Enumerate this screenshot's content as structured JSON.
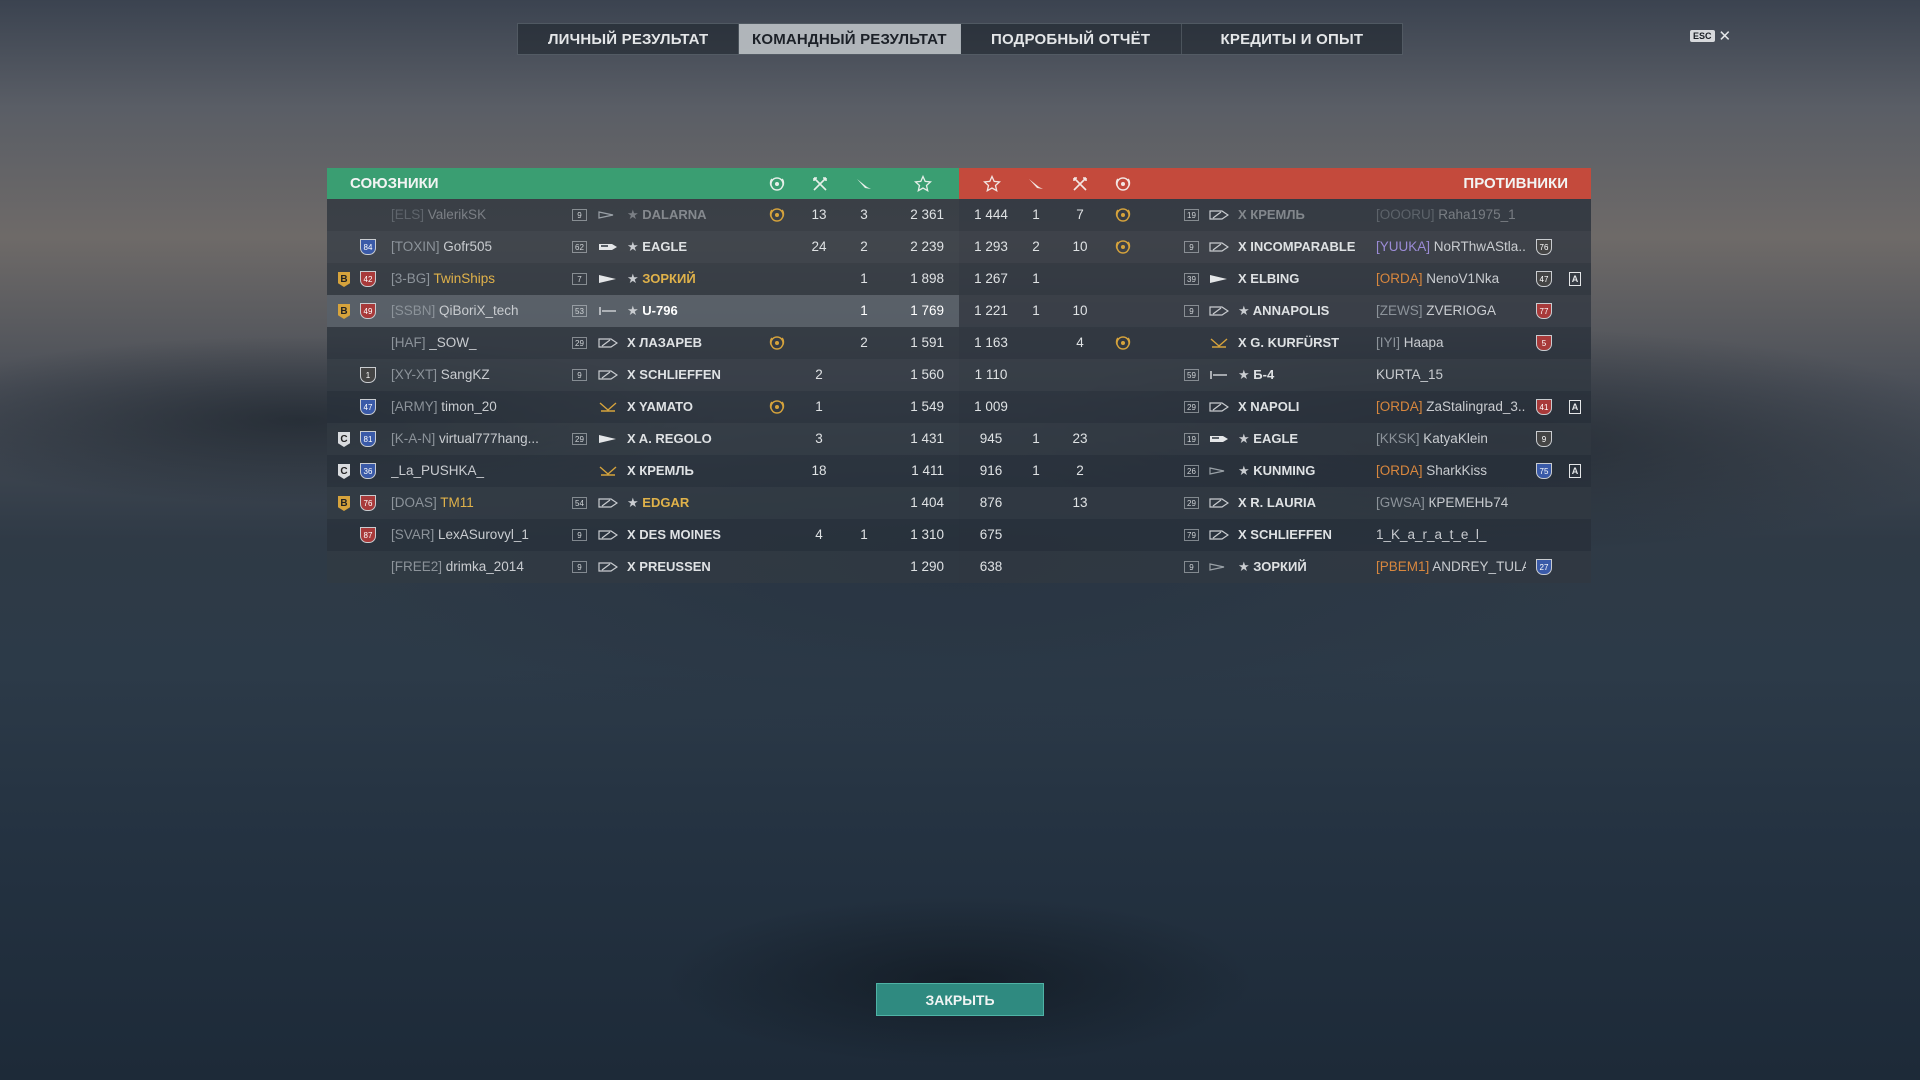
{
  "tabs": [
    {
      "label": "ЛИЧНЫЙ РЕЗУЛЬТАТ",
      "active": false
    },
    {
      "label": "КОМАНДНЫЙ РЕЗУЛЬТАТ",
      "active": true
    },
    {
      "label": "ПОДРОБНЫЙ ОТЧЁТ",
      "active": false
    },
    {
      "label": "КРЕДИТЫ И ОПЫТ",
      "active": false
    }
  ],
  "esc": {
    "key": "ESC",
    "icon": "close-icon"
  },
  "allies": {
    "title": "СОЮЗНИКИ",
    "color": "#3a9e72",
    "columns": [
      "laurel-icon",
      "frags-icon",
      "planes-icon",
      "star-icon"
    ],
    "rows": [
      {
        "badge": "",
        "rank": "",
        "rank_color": "",
        "clan": "[ELS]",
        "name": "ValerikSK",
        "level": "9",
        "ship_type": "cruiser",
        "premium_star": true,
        "ship": "DALARNA",
        "laurel": true,
        "frags": "13",
        "planes": "3",
        "xp": "2 361",
        "dim": true
      },
      {
        "badge": "",
        "rank": "84",
        "rank_color": "#3a5aa8",
        "clan": "[TOXIN]",
        "name": "Gofr505",
        "level": "62",
        "ship_type": "carrier",
        "premium_star": true,
        "ship": "EAGLE",
        "laurel": false,
        "frags": "24",
        "planes": "2",
        "xp": "2 239",
        "dim": false
      },
      {
        "badge": "B",
        "rank": "42",
        "rank_color": "#a83a3a",
        "clan": "[3-BG]",
        "name": "TwinShips",
        "level": "7",
        "ship_type": "destroyer",
        "premium_star": true,
        "ship": "ЗОРКИЙ",
        "laurel": false,
        "frags": "",
        "planes": "1",
        "xp": "1 898",
        "dim": false,
        "gold": true
      },
      {
        "badge": "B",
        "rank": "49",
        "rank_color": "#a83a3a",
        "clan": "[SSBN]",
        "name": "QiBoriX_tech",
        "level": "53",
        "ship_type": "submarine",
        "premium_star": true,
        "ship": "U-796",
        "laurel": false,
        "frags": "",
        "planes": "1",
        "xp": "1 769",
        "dim": false,
        "me": true
      },
      {
        "badge": "",
        "rank": "",
        "rank_color": "",
        "clan": "[HAF]",
        "name": "_SOW_",
        "level": "29",
        "ship_type": "battleship",
        "premium_star": false,
        "ship": "X ЛАЗАРЕВ",
        "laurel": true,
        "frags": "",
        "planes": "2",
        "xp": "1 591",
        "dim": false
      },
      {
        "badge": "",
        "rank": "1",
        "rank_color": "#444",
        "clan": "[XY-XT]",
        "name": "SangKZ",
        "level": "9",
        "ship_type": "battleship",
        "premium_star": false,
        "ship": "X SCHLIEFFEN",
        "laurel": false,
        "frags": "2",
        "planes": "",
        "xp": "1 560",
        "dim": false
      },
      {
        "badge": "",
        "rank": "47",
        "rank_color": "#3a5aa8",
        "clan": "[ARMY]",
        "name": "timon_20",
        "level": "",
        "ship_type": "submarine-v",
        "premium_star": false,
        "ship": "X YAMATO",
        "laurel": true,
        "frags": "1",
        "planes": "",
        "xp": "1 549",
        "dim": false
      },
      {
        "badge": "C",
        "rank": "81",
        "rank_color": "#3a5aa8",
        "clan": "[K-A-N]",
        "name": "virtual777hang...",
        "level": "29",
        "ship_type": "destroyer",
        "premium_star": false,
        "ship": "X A. REGOLO",
        "laurel": false,
        "frags": "3",
        "planes": "",
        "xp": "1 431",
        "dim": false
      },
      {
        "badge": "C",
        "rank": "36",
        "rank_color": "#3a5aa8",
        "clan": "",
        "name": "_La_PUSHKA_",
        "level": "",
        "ship_type": "submarine-v",
        "premium_star": false,
        "ship": "X КРЕМЛЬ",
        "laurel": false,
        "frags": "18",
        "planes": "",
        "xp": "1 411",
        "dim": false
      },
      {
        "badge": "B",
        "rank": "76",
        "rank_color": "#a83a3a",
        "clan": "[DOAS]",
        "name": "TM11",
        "level": "54",
        "ship_type": "battleship",
        "premium_star": true,
        "ship": "EDGAR",
        "laurel": false,
        "frags": "",
        "planes": "",
        "xp": "1 404",
        "dim": false,
        "gold": true
      },
      {
        "badge": "",
        "rank": "87",
        "rank_color": "#a83a3a",
        "clan": "[SVAR]",
        "name": "LexASurovyl_1",
        "level": "9",
        "ship_type": "battleship",
        "premium_star": false,
        "ship": "X DES MOINES",
        "laurel": false,
        "frags": "4",
        "planes": "1",
        "xp": "1 310",
        "dim": false
      },
      {
        "badge": "",
        "rank": "",
        "rank_color": "",
        "clan": "[FREE2]",
        "name": "drimka_2014",
        "level": "9",
        "ship_type": "battleship",
        "premium_star": false,
        "ship": "X PREUSSEN",
        "laurel": false,
        "frags": "",
        "planes": "",
        "xp": "1 290",
        "dim": false
      }
    ]
  },
  "enemies": {
    "title": "ПРОТИВНИКИ",
    "color": "#c44a3c",
    "columns": [
      "star-icon",
      "planes-icon",
      "frags-icon",
      "laurel-icon"
    ],
    "rows": [
      {
        "xp": "1 444",
        "planes": "1",
        "frags": "7",
        "laurel": true,
        "level": "19",
        "ship_type": "battleship",
        "premium_star": false,
        "ship": "X КРЕМЛЬ",
        "clan": "[OOORU]",
        "clan_style": "",
        "name": "Raha1975_1",
        "rank": "",
        "rank_color": "",
        "a": false,
        "dim": true
      },
      {
        "xp": "1 293",
        "planes": "2",
        "frags": "10",
        "laurel": true,
        "level": "9",
        "ship_type": "battleship",
        "premium_star": false,
        "ship": "X INCOMPARABLE",
        "clan": "[YUUKA]",
        "clan_style": "purple",
        "name": "NoRThwAStla...",
        "rank": "76",
        "rank_color": "#444",
        "a": false,
        "dim": false
      },
      {
        "xp": "1 267",
        "planes": "1",
        "frags": "",
        "laurel": false,
        "level": "39",
        "ship_type": "destroyer",
        "premium_star": false,
        "ship": "X ELBING",
        "clan": "[ORDA]",
        "clan_style": "orange",
        "name": "NenoV1Nka",
        "rank": "47",
        "rank_color": "#444",
        "a": true,
        "dim": false
      },
      {
        "xp": "1 221",
        "planes": "1",
        "frags": "10",
        "laurel": false,
        "level": "9",
        "ship_type": "battleship",
        "premium_star": true,
        "ship": "ANNAPOLIS",
        "clan": "[ZEWS]",
        "clan_style": "",
        "name": "ZVERIOGA",
        "rank": "77",
        "rank_color": "#a83a3a",
        "a": false,
        "dim": false
      },
      {
        "xp": "1 163",
        "planes": "",
        "frags": "4",
        "laurel": true,
        "level": "",
        "ship_type": "submarine-v",
        "premium_star": false,
        "ship": "X G. KURFÜRST",
        "clan": "[IYI]",
        "clan_style": "",
        "name": "Haapa",
        "rank": "5",
        "rank_color": "#a83a3a",
        "a": false,
        "dim": false
      },
      {
        "xp": "1 110",
        "planes": "",
        "frags": "",
        "laurel": false,
        "level": "59",
        "ship_type": "submarine",
        "premium_star": true,
        "ship": "Б-4",
        "clan": "",
        "clan_style": "",
        "name": "KURTA_15",
        "rank": "",
        "rank_color": "",
        "a": false,
        "dim": false
      },
      {
        "xp": "1 009",
        "planes": "",
        "frags": "",
        "laurel": false,
        "level": "29",
        "ship_type": "battleship",
        "premium_star": false,
        "ship": "X NAPOLI",
        "clan": "[ORDA]",
        "clan_style": "orange",
        "name": "ZaStalingrad_3...",
        "rank": "41",
        "rank_color": "#a83a3a",
        "a": true,
        "dim": false
      },
      {
        "xp": "945",
        "planes": "1",
        "frags": "23",
        "laurel": false,
        "level": "19",
        "ship_type": "carrier",
        "premium_star": true,
        "ship": "EAGLE",
        "clan": "[KKSK]",
        "clan_style": "",
        "name": "KatyaKlein",
        "rank": "9",
        "rank_color": "#444",
        "a": false,
        "dim": false
      },
      {
        "xp": "916",
        "planes": "1",
        "frags": "2",
        "laurel": false,
        "level": "26",
        "ship_type": "cruiser",
        "premium_star": true,
        "ship": "KUNMING",
        "clan": "[ORDA]",
        "clan_style": "orange",
        "name": "SharkKiss",
        "rank": "75",
        "rank_color": "#3a5aa8",
        "a": true,
        "dim": false
      },
      {
        "xp": "876",
        "planes": "",
        "frags": "13",
        "laurel": false,
        "level": "29",
        "ship_type": "battleship",
        "premium_star": false,
        "ship": "X R. LAURIA",
        "clan": "[GWSA]",
        "clan_style": "",
        "name": "КРЕМЕНЬ74",
        "rank": "",
        "rank_color": "",
        "a": false,
        "dim": false
      },
      {
        "xp": "675",
        "planes": "",
        "frags": "",
        "laurel": false,
        "level": "79",
        "ship_type": "battleship",
        "premium_star": false,
        "ship": "X SCHLIEFFEN",
        "clan": "",
        "clan_style": "",
        "name": "1_K_a_r_a_t_e_l_",
        "rank": "",
        "rank_color": "",
        "a": false,
        "dim": false
      },
      {
        "xp": "638",
        "planes": "",
        "frags": "",
        "laurel": false,
        "level": "9",
        "ship_type": "cruiser",
        "premium_star": true,
        "ship": "ЗОРКИЙ",
        "clan": "[PBEM1]",
        "clan_style": "orange",
        "name": "ANDREY_TULA",
        "rank": "27",
        "rank_color": "#3a5aa8",
        "a": false,
        "dim": false
      }
    ]
  },
  "close_button": {
    "label": "ЗАКРЫТЬ"
  }
}
